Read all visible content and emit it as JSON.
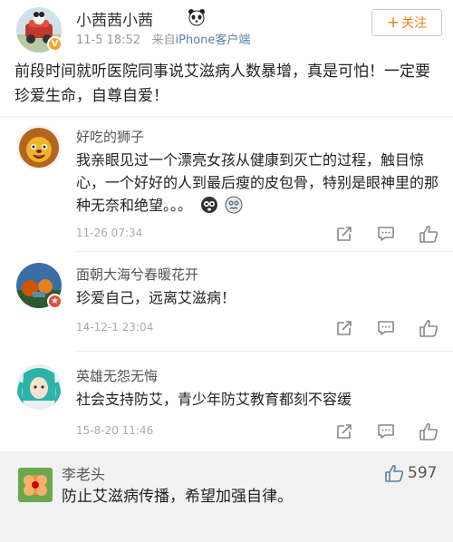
{
  "post": {
    "username": "小茜茜小茜",
    "time": "11-5 18:52",
    "source_prefix": "来自",
    "source": "iPhone客户端",
    "follow_label": "关注",
    "text": "前段时间就听医院同事说艾滋病人数暴增，真是可怕！一定要珍爱生命，自尊自爱！"
  },
  "comments": [
    {
      "name": "好吃的狮子",
      "text": "我亲眼见过一个漂亮女孩从健康到灭亡的过程，触目惊心，一个好好的人到最后瘦的皮包骨，特别是眼神里的那种无奈和绝望。。。",
      "time": "11-26 07:34"
    },
    {
      "name": "面朝大海兮春暖花开",
      "text": "珍爱自己，远离艾滋病！",
      "time": "14-12-1 23:04"
    },
    {
      "name": "英雄无怨无悔",
      "text": "社会支持防艾，青少年防艾教育都刻不容缓",
      "time": "15-8-20 11:46"
    },
    {
      "name": "李老头",
      "text": "防止艾滋病传播，希望加强自律。",
      "likes": "597"
    }
  ],
  "colors": {
    "follow": "#f47f0f",
    "verified": "#f5a623",
    "source_link": "#5b7fa6"
  }
}
